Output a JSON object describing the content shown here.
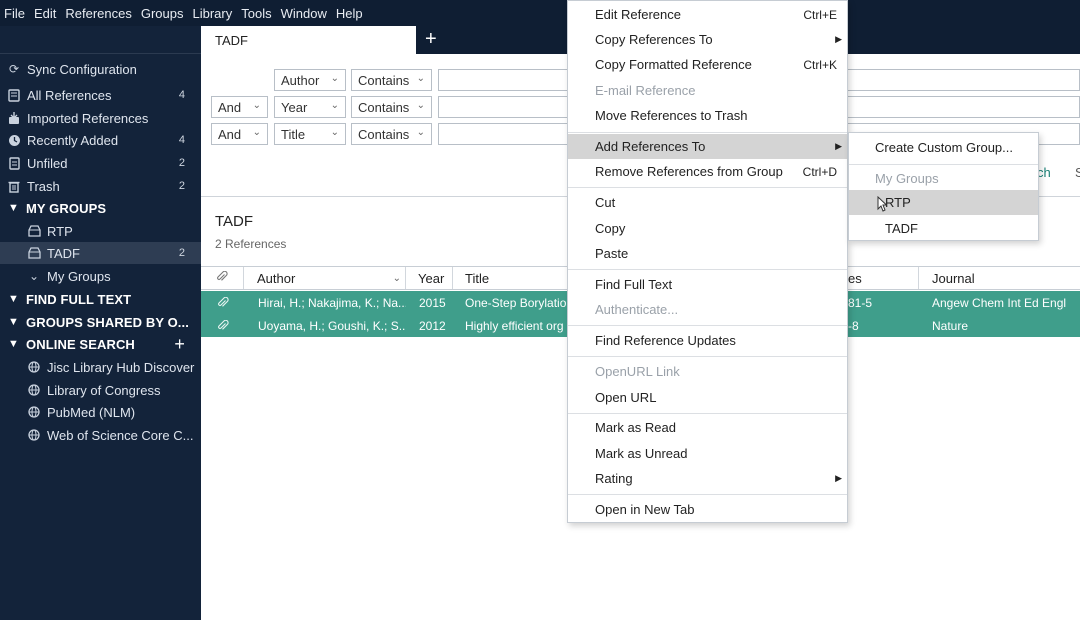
{
  "menubar": [
    "File",
    "Edit",
    "References",
    "Groups",
    "Library",
    "Tools",
    "Window",
    "Help"
  ],
  "sidebar": {
    "sync": "Sync Configuration",
    "items": [
      {
        "label": "All References",
        "count": "4",
        "icon": "books-icon"
      },
      {
        "label": "Imported References",
        "count": "",
        "icon": "import-icon"
      },
      {
        "label": "Recently Added",
        "count": "4",
        "icon": "clock-icon"
      },
      {
        "label": "Unfiled",
        "count": "2",
        "icon": "document-icon"
      },
      {
        "label": "Trash",
        "count": "2",
        "icon": "trash-icon"
      }
    ],
    "my_groups_header": "MY GROUPS",
    "groups": [
      {
        "label": "RTP",
        "count": ""
      },
      {
        "label": "TADF",
        "count": "2"
      }
    ],
    "my_groups_sub": "My Groups",
    "find_full_text": "FIND FULL TEXT",
    "groups_shared": "GROUPS SHARED BY O...",
    "online_search": "ONLINE SEARCH",
    "online_add": "+",
    "online_items": [
      "Jisc Library Hub Discover",
      "Library of Congress",
      "PubMed (NLM)",
      "Web of Science Core C..."
    ]
  },
  "tab": {
    "label": "TADF",
    "add": "+"
  },
  "search": {
    "rows": [
      {
        "bool": "",
        "field": "Author",
        "op": "Contains"
      },
      {
        "bool": "And",
        "field": "Year",
        "op": "Contains"
      },
      {
        "bool": "And",
        "field": "Title",
        "op": "Contains"
      }
    ],
    "link1": "ch",
    "link2": "S"
  },
  "results": {
    "group_title": "TADF",
    "count_text": "2 References",
    "columns": {
      "author": "Author",
      "year": "Year",
      "title": "Title",
      "pages": "es",
      "journal": "Journal"
    },
    "rows": [
      {
        "author": "Hirai, H.; Nakajima, K.; Na...",
        "year": "2015",
        "title": "One-Step Borylatio",
        "pages": "81-5",
        "journal": "Angew Chem Int Ed Engl"
      },
      {
        "author": "Uoyama, H.; Goushi, K.; S...",
        "year": "2012",
        "title": "Highly efficient org",
        "pages": "-8",
        "journal": "Nature"
      }
    ]
  },
  "context_menu": {
    "items": [
      {
        "label": "Edit Reference",
        "shortcut": "Ctrl+E"
      },
      {
        "label": "Copy References To",
        "shortcut": ""
      },
      {
        "label": "Copy Formatted Reference",
        "shortcut": "Ctrl+K"
      },
      {
        "label": "E-mail Reference",
        "shortcut": ""
      },
      {
        "label": "Move References to Trash",
        "shortcut": ""
      },
      {
        "label": "Add References To",
        "shortcut": ""
      },
      {
        "label": "Remove References from Group",
        "shortcut": "Ctrl+D"
      },
      {
        "label": "Cut",
        "shortcut": ""
      },
      {
        "label": "Copy",
        "shortcut": ""
      },
      {
        "label": "Paste",
        "shortcut": ""
      },
      {
        "label": "Find Full Text",
        "shortcut": ""
      },
      {
        "label": "Authenticate...",
        "shortcut": ""
      },
      {
        "label": "Find Reference Updates",
        "shortcut": ""
      },
      {
        "label": "OpenURL Link",
        "shortcut": ""
      },
      {
        "label": "Open URL",
        "shortcut": ""
      },
      {
        "label": "Mark as Read",
        "shortcut": ""
      },
      {
        "label": "Mark as Unread",
        "shortcut": ""
      },
      {
        "label": "Rating",
        "shortcut": ""
      },
      {
        "label": "Open in New Tab",
        "shortcut": ""
      }
    ]
  },
  "submenu": {
    "items": [
      "Create Custom Group...",
      "My Groups",
      "RTP",
      "TADF"
    ]
  },
  "colors": {
    "sidebar_bg": "#13233a",
    "menubar_bg": "#0f1e33",
    "row_selected": "#3f9e8b",
    "menu_highlight": "#d4d4d4"
  }
}
